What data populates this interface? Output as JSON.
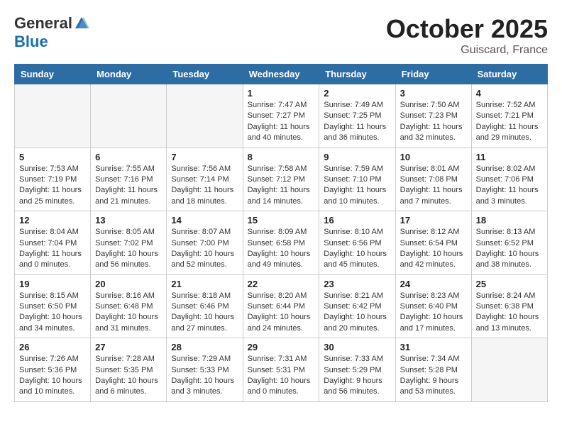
{
  "header": {
    "logo_general": "General",
    "logo_blue": "Blue",
    "month_title": "October 2025",
    "location": "Guiscard, France"
  },
  "weekdays": [
    "Sunday",
    "Monday",
    "Tuesday",
    "Wednesday",
    "Thursday",
    "Friday",
    "Saturday"
  ],
  "weeks": [
    [
      {
        "day": "",
        "info": ""
      },
      {
        "day": "",
        "info": ""
      },
      {
        "day": "",
        "info": ""
      },
      {
        "day": "1",
        "info": "Sunrise: 7:47 AM\nSunset: 7:27 PM\nDaylight: 11 hours\nand 40 minutes."
      },
      {
        "day": "2",
        "info": "Sunrise: 7:49 AM\nSunset: 7:25 PM\nDaylight: 11 hours\nand 36 minutes."
      },
      {
        "day": "3",
        "info": "Sunrise: 7:50 AM\nSunset: 7:23 PM\nDaylight: 11 hours\nand 32 minutes."
      },
      {
        "day": "4",
        "info": "Sunrise: 7:52 AM\nSunset: 7:21 PM\nDaylight: 11 hours\nand 29 minutes."
      }
    ],
    [
      {
        "day": "5",
        "info": "Sunrise: 7:53 AM\nSunset: 7:19 PM\nDaylight: 11 hours\nand 25 minutes."
      },
      {
        "day": "6",
        "info": "Sunrise: 7:55 AM\nSunset: 7:16 PM\nDaylight: 11 hours\nand 21 minutes."
      },
      {
        "day": "7",
        "info": "Sunrise: 7:56 AM\nSunset: 7:14 PM\nDaylight: 11 hours\nand 18 minutes."
      },
      {
        "day": "8",
        "info": "Sunrise: 7:58 AM\nSunset: 7:12 PM\nDaylight: 11 hours\nand 14 minutes."
      },
      {
        "day": "9",
        "info": "Sunrise: 7:59 AM\nSunset: 7:10 PM\nDaylight: 11 hours\nand 10 minutes."
      },
      {
        "day": "10",
        "info": "Sunrise: 8:01 AM\nSunset: 7:08 PM\nDaylight: 11 hours\nand 7 minutes."
      },
      {
        "day": "11",
        "info": "Sunrise: 8:02 AM\nSunset: 7:06 PM\nDaylight: 11 hours\nand 3 minutes."
      }
    ],
    [
      {
        "day": "12",
        "info": "Sunrise: 8:04 AM\nSunset: 7:04 PM\nDaylight: 11 hours\nand 0 minutes."
      },
      {
        "day": "13",
        "info": "Sunrise: 8:05 AM\nSunset: 7:02 PM\nDaylight: 10 hours\nand 56 minutes."
      },
      {
        "day": "14",
        "info": "Sunrise: 8:07 AM\nSunset: 7:00 PM\nDaylight: 10 hours\nand 52 minutes."
      },
      {
        "day": "15",
        "info": "Sunrise: 8:09 AM\nSunset: 6:58 PM\nDaylight: 10 hours\nand 49 minutes."
      },
      {
        "day": "16",
        "info": "Sunrise: 8:10 AM\nSunset: 6:56 PM\nDaylight: 10 hours\nand 45 minutes."
      },
      {
        "day": "17",
        "info": "Sunrise: 8:12 AM\nSunset: 6:54 PM\nDaylight: 10 hours\nand 42 minutes."
      },
      {
        "day": "18",
        "info": "Sunrise: 8:13 AM\nSunset: 6:52 PM\nDaylight: 10 hours\nand 38 minutes."
      }
    ],
    [
      {
        "day": "19",
        "info": "Sunrise: 8:15 AM\nSunset: 6:50 PM\nDaylight: 10 hours\nand 34 minutes."
      },
      {
        "day": "20",
        "info": "Sunrise: 8:16 AM\nSunset: 6:48 PM\nDaylight: 10 hours\nand 31 minutes."
      },
      {
        "day": "21",
        "info": "Sunrise: 8:18 AM\nSunset: 6:46 PM\nDaylight: 10 hours\nand 27 minutes."
      },
      {
        "day": "22",
        "info": "Sunrise: 8:20 AM\nSunset: 6:44 PM\nDaylight: 10 hours\nand 24 minutes."
      },
      {
        "day": "23",
        "info": "Sunrise: 8:21 AM\nSunset: 6:42 PM\nDaylight: 10 hours\nand 20 minutes."
      },
      {
        "day": "24",
        "info": "Sunrise: 8:23 AM\nSunset: 6:40 PM\nDaylight: 10 hours\nand 17 minutes."
      },
      {
        "day": "25",
        "info": "Sunrise: 8:24 AM\nSunset: 6:38 PM\nDaylight: 10 hours\nand 13 minutes."
      }
    ],
    [
      {
        "day": "26",
        "info": "Sunrise: 7:26 AM\nSunset: 5:36 PM\nDaylight: 10 hours\nand 10 minutes."
      },
      {
        "day": "27",
        "info": "Sunrise: 7:28 AM\nSunset: 5:35 PM\nDaylight: 10 hours\nand 6 minutes."
      },
      {
        "day": "28",
        "info": "Sunrise: 7:29 AM\nSunset: 5:33 PM\nDaylight: 10 hours\nand 3 minutes."
      },
      {
        "day": "29",
        "info": "Sunrise: 7:31 AM\nSunset: 5:31 PM\nDaylight: 10 hours\nand 0 minutes."
      },
      {
        "day": "30",
        "info": "Sunrise: 7:33 AM\nSunset: 5:29 PM\nDaylight: 9 hours\nand 56 minutes."
      },
      {
        "day": "31",
        "info": "Sunrise: 7:34 AM\nSunset: 5:28 PM\nDaylight: 9 hours\nand 53 minutes."
      },
      {
        "day": "",
        "info": ""
      }
    ]
  ]
}
